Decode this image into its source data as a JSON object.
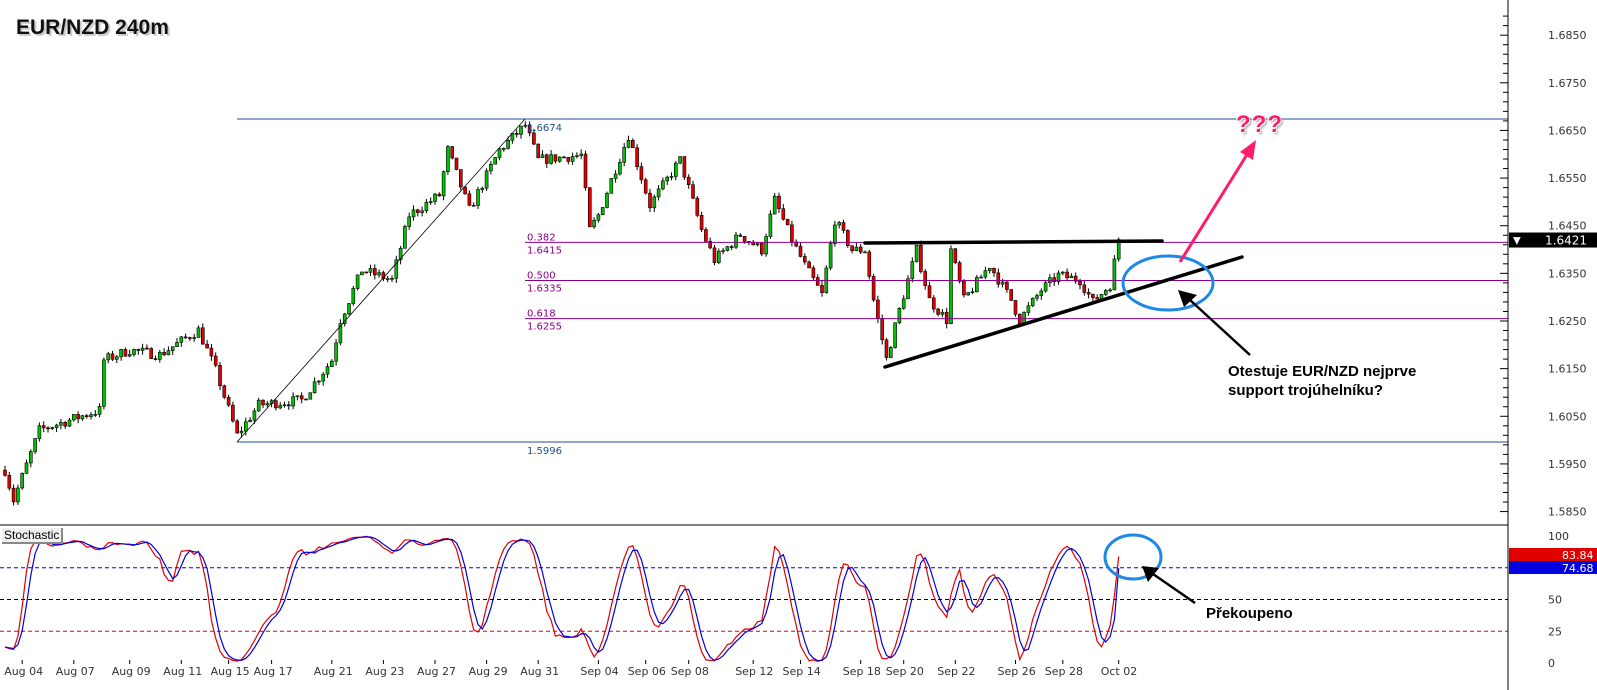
{
  "header": {
    "title": "EUR/NZD 240m"
  },
  "indicator": {
    "name": "Stochastic",
    "k_value": "83.84",
    "d_value": "74.68"
  },
  "current_price": "1.6421",
  "annotations": {
    "question": "???",
    "note_line1": "Otestuje EUR/NZD nejprve",
    "note_line2": "support trojúhelníku?",
    "overbought": "Překoupeno"
  },
  "fibonacci": {
    "high_label": "1.6674",
    "low_label": "1.5996",
    "levels": [
      {
        "ratio": "0.382",
        "price": "1.6415"
      },
      {
        "ratio": "0.500",
        "price": "1.6335"
      },
      {
        "ratio": "0.618",
        "price": "1.6255"
      }
    ]
  },
  "colors": {
    "up": "#00c000",
    "down": "#e00000",
    "fib": "#8b008b",
    "range": "#1f4e8c",
    "k_line": "#e00000",
    "d_line": "#0000e0",
    "ellipse": "#1e88e5",
    "arrow_pink": "#ff1c6b"
  },
  "chart_data": {
    "type": "candlestick",
    "title": "EUR/NZD 240m",
    "price_ticks": [
      "1.6850",
      "1.6750",
      "1.6650",
      "1.6550",
      "1.6450",
      "1.6350",
      "1.6250",
      "1.6150",
      "1.6050",
      "1.5950",
      "1.5850"
    ],
    "price_range": [
      1.581,
      1.692
    ],
    "close_keypoints": [
      [
        0,
        1.5937
      ],
      [
        2,
        1.5874
      ],
      [
        8,
        1.6021
      ],
      [
        15,
        1.6042
      ],
      [
        22,
        1.6063
      ],
      [
        23,
        1.6168
      ],
      [
        29,
        1.6189
      ],
      [
        36,
        1.6179
      ],
      [
        45,
        1.6231
      ],
      [
        49,
        1.6147
      ],
      [
        54,
        1.601
      ],
      [
        59,
        1.6074
      ],
      [
        69,
        1.6084
      ],
      [
        76,
        1.6168
      ],
      [
        78,
        1.6252
      ],
      [
        83,
        1.6357
      ],
      [
        90,
        1.6336
      ],
      [
        94,
        1.6472
      ],
      [
        101,
        1.6514
      ],
      [
        103,
        1.6609
      ],
      [
        108,
        1.6483
      ],
      [
        115,
        1.6609
      ],
      [
        121,
        1.6661
      ],
      [
        124,
        1.6588
      ],
      [
        134,
        1.6598
      ],
      [
        136,
        1.6441
      ],
      [
        138,
        1.6472
      ],
      [
        141,
        1.6546
      ],
      [
        145,
        1.664
      ],
      [
        150,
        1.6493
      ],
      [
        157,
        1.6588
      ],
      [
        162,
        1.6441
      ],
      [
        165,
        1.6378
      ],
      [
        171,
        1.6431
      ],
      [
        176,
        1.6399
      ],
      [
        179,
        1.6504
      ],
      [
        183,
        1.642
      ],
      [
        186,
        1.6367
      ],
      [
        190,
        1.6305
      ],
      [
        193,
        1.6462
      ],
      [
        197,
        1.6399
      ],
      [
        200,
        1.6399
      ],
      [
        202,
        1.6294
      ],
      [
        205,
        1.617
      ],
      [
        208,
        1.6273
      ],
      [
        212,
        1.6399
      ],
      [
        215,
        1.6294
      ],
      [
        219,
        1.6252
      ],
      [
        220,
        1.6399
      ],
      [
        223,
        1.6294
      ],
      [
        229,
        1.6367
      ],
      [
        234,
        1.6294
      ],
      [
        236,
        1.6252
      ],
      [
        241,
        1.6315
      ],
      [
        245,
        1.6346
      ],
      [
        250,
        1.6336
      ],
      [
        253,
        1.629
      ],
      [
        257,
        1.6326
      ],
      [
        259,
        1.6421
      ]
    ],
    "stochastic": {
      "levels": [
        75,
        50,
        25
      ],
      "ticks": [
        "100",
        "50",
        "25",
        "0"
      ],
      "range": [
        0,
        100
      ],
      "last_k": 83.84,
      "last_d": 74.68
    },
    "x_labels": [
      [
        "Aug 04",
        4
      ],
      [
        "Aug 07",
        16
      ],
      [
        "Aug 09",
        29
      ],
      [
        "Aug 11",
        41
      ],
      [
        "Aug 15",
        52
      ],
      [
        "Aug 17",
        62
      ],
      [
        "Aug 21",
        76
      ],
      [
        "Aug 23",
        88
      ],
      [
        "Aug 27",
        100
      ],
      [
        "Aug 29",
        112
      ],
      [
        "Aug 31",
        124
      ],
      [
        "Sep 04",
        138
      ],
      [
        "Sep 06",
        149
      ],
      [
        "Sep 08",
        159
      ],
      [
        "Sep 12",
        174
      ],
      [
        "Sep 14",
        185
      ],
      [
        "Sep 18",
        199
      ],
      [
        "Sep 20",
        209
      ],
      [
        "Sep 22",
        221
      ],
      [
        "Sep 26",
        235
      ],
      [
        "Sep 28",
        246
      ],
      [
        "Oct 02",
        259
      ]
    ]
  }
}
